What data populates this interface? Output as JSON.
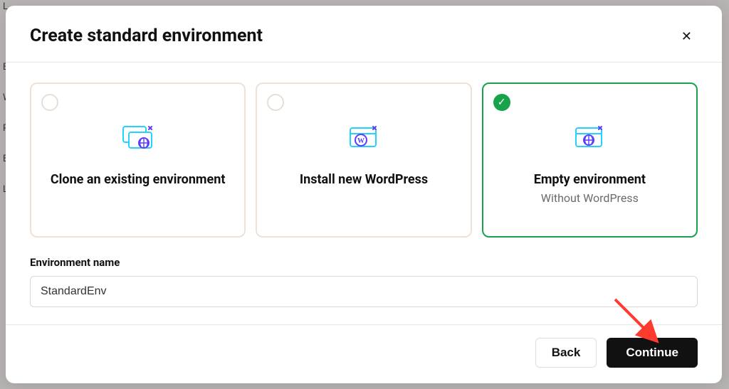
{
  "modal": {
    "title": "Create standard environment",
    "options": [
      {
        "title": "Clone an existing environment",
        "subtitle": ""
      },
      {
        "title": "Install new WordPress",
        "subtitle": ""
      },
      {
        "title": "Empty environment",
        "subtitle": "Without WordPress"
      }
    ],
    "name_label": "Environment name",
    "name_value": "StandardEnv",
    "back_label": "Back",
    "continue_label": "Continue"
  }
}
